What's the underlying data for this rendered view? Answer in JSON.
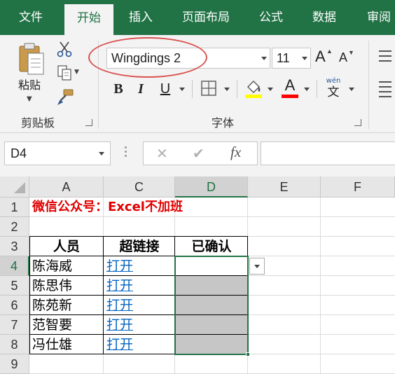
{
  "ribbon_tabs": [
    "文件",
    "开始",
    "插入",
    "页面布局",
    "公式",
    "数据",
    "审阅"
  ],
  "active_tab": "开始",
  "clipboard": {
    "paste_label": "粘贴",
    "group_label": "剪贴板"
  },
  "font": {
    "font_name": "Wingdings 2",
    "font_size": "11",
    "grow_label": "A",
    "shrink_label": "A",
    "bold_label": "B",
    "italic_label": "I",
    "underline_label": "U",
    "font_color_letter": "A",
    "phonetic_top": "wén",
    "phonetic_char": "文",
    "group_label": "字体",
    "highlight_color": "#ffff00",
    "font_color": "#ff0000",
    "annotation_color": "#d9534f"
  },
  "formula_bar": {
    "name_box": "D4",
    "cancel_icon": "✕",
    "enter_icon": "✔",
    "fx_label": "fx",
    "formula": ""
  },
  "grid": {
    "columns": [
      "A",
      "C",
      "D",
      "E",
      "F"
    ],
    "rows": [
      "1",
      "2",
      "3",
      "4",
      "5",
      "6",
      "7",
      "8",
      "9"
    ],
    "selected_column": "D",
    "selected_row": "4",
    "title": "微信公众号：Excel不加班",
    "table_headers": [
      "人员",
      "超链接",
      "已确认"
    ],
    "table_rows": [
      {
        "person": "陈海威",
        "link": "打开",
        "confirmed": ""
      },
      {
        "person": "陈思伟",
        "link": "打开",
        "confirmed": ""
      },
      {
        "person": "陈苑新",
        "link": "打开",
        "confirmed": ""
      },
      {
        "person": "范智要",
        "link": "打开",
        "confirmed": ""
      },
      {
        "person": "冯仕雄",
        "link": "打开",
        "confirmed": ""
      }
    ]
  },
  "colors": {
    "excel_green": "#217346",
    "title_red": "#e00000",
    "link_blue": "#0563c1"
  }
}
